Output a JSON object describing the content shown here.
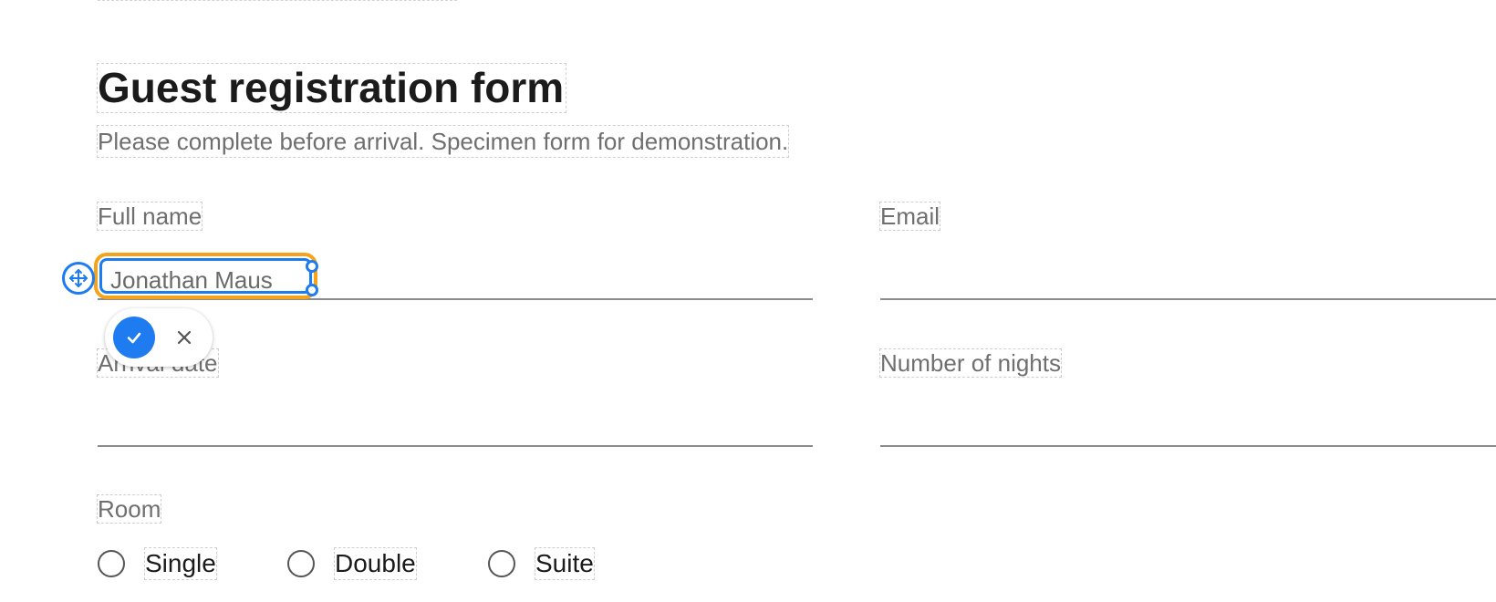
{
  "form": {
    "title": "Guest registration form",
    "subtitle": "Please complete before arrival. Specimen form for demonstration.",
    "fields": {
      "full_name": {
        "label": "Full name",
        "value": ""
      },
      "email": {
        "label": "Email",
        "value": ""
      },
      "arrival_date": {
        "label": "Arrival date",
        "value": ""
      },
      "nights": {
        "label": "Number of nights",
        "value": ""
      }
    },
    "room": {
      "label": "Room",
      "options": [
        "Single",
        "Double",
        "Suite"
      ]
    }
  },
  "annotation": {
    "text": "Jonathan Maus",
    "accent_color": "#1f7cf0",
    "focus_color": "#f5a31a",
    "icons": {
      "move": "move-icon",
      "confirm": "check-icon",
      "cancel": "close-icon"
    }
  }
}
